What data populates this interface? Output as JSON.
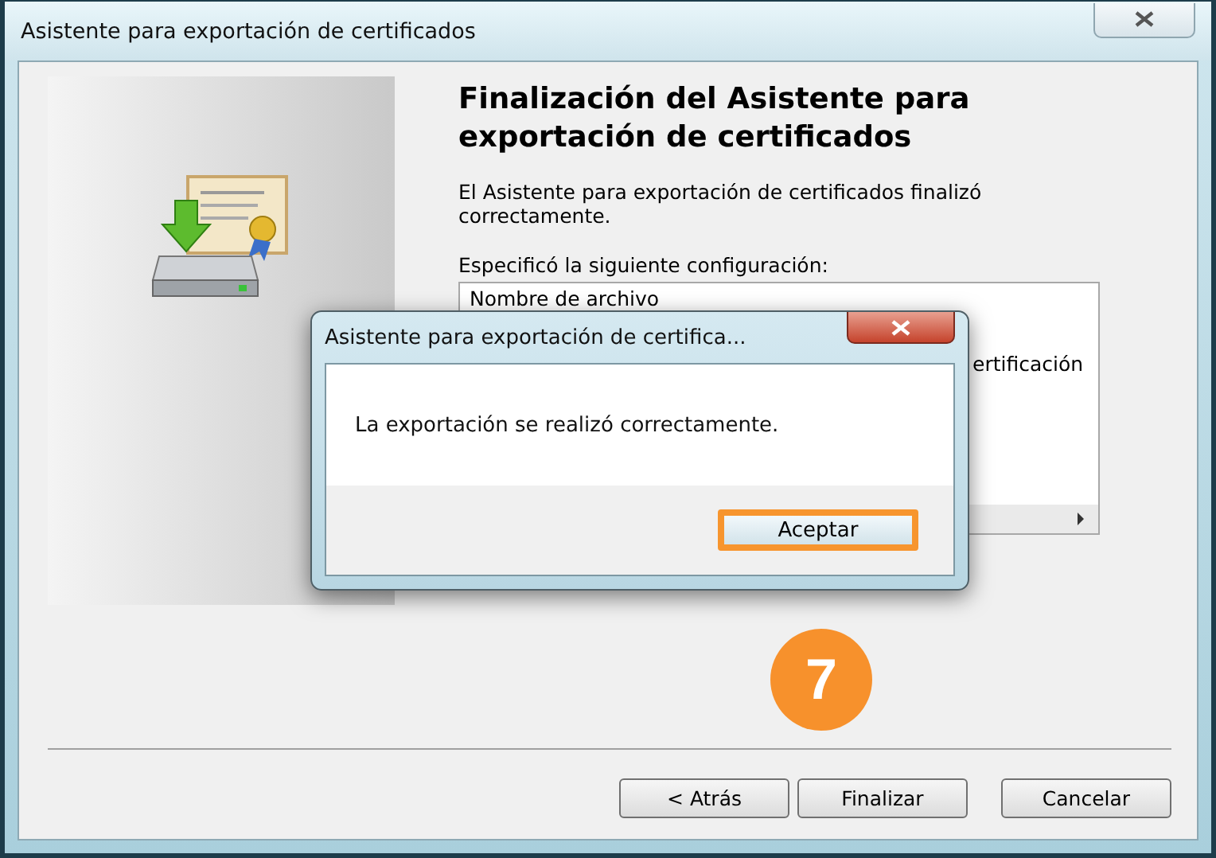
{
  "window": {
    "title": "Asistente para exportación de certificados"
  },
  "heading": "Finalización del Asistente para exportación de certificados",
  "message": "El Asistente para exportación de certificados finalizó correctamente.",
  "settings_label": "Especificó la siguiente configuración:",
  "settings_list": [
    "Nombre de archivo",
    "ertificación"
  ],
  "buttons": [
    {
      "label": "< Atrás"
    },
    {
      "label": "Finalizar"
    },
    {
      "label": "Cancelar"
    }
  ],
  "dialog": {
    "title": "Asistente para exportación de certifica...",
    "message": "La exportación se realizó correctamente.",
    "button": {
      "label": "Aceptar",
      "highlighted": true
    }
  },
  "step_badge": "7"
}
